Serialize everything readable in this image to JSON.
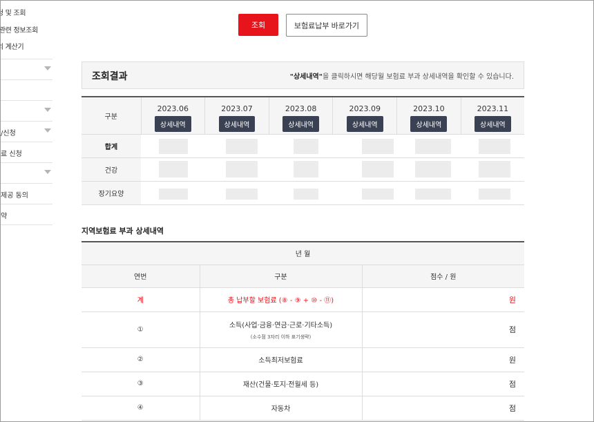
{
  "sidebar": {
    "sub_items": [
      "신청 및 조회",
      "료 관련 정보조회",
      "로의 계산기"
    ],
    "menu_items": [
      {
        "label": ""
      },
      {
        "label": ""
      },
      {
        "label": ""
      },
      {
        "label": "/신청"
      },
      {
        "label": "료 신청"
      },
      {
        "label": ""
      },
      {
        "label": "제공 동의"
      },
      {
        "label": "약"
      }
    ]
  },
  "actions": {
    "search_label": "조회",
    "pay_label": "보험료납부 바로가기"
  },
  "result": {
    "title": "조회결과",
    "info_bold": "\"상세내역\"",
    "info_rest": "을 클릭하시면 해당월 보험료 부과 상세내역을 확인할 수 있습니다."
  },
  "monthly_table": {
    "corner_label": "구분",
    "detail_label": "상세내역",
    "months": [
      "2023.06",
      "2023.07",
      "2023.08",
      "2023.09",
      "2023.10",
      "2023.11"
    ],
    "rows": [
      "합계",
      "건강",
      "장기요양"
    ]
  },
  "detail": {
    "title": "지역보험료 부과 상세내역",
    "period_header": "년 월",
    "col_no": "연번",
    "col_category": "구분",
    "col_score": "점수 / 원",
    "rows": [
      {
        "no": "계",
        "category": "총 납부할 보험료 (⑧ - ⑨ + ⑩ - ⑪)",
        "note": "",
        "unit": "원",
        "total": true
      },
      {
        "no": "①",
        "category": "소득(사업·금융·연금·근로·기타소득)",
        "note": "(소수점 3자리 이하 표기생략)",
        "unit": "점",
        "total": false
      },
      {
        "no": "②",
        "category": "소득최저보험료",
        "note": "",
        "unit": "원",
        "total": false
      },
      {
        "no": "③",
        "category": "재산(건물·토지·전월세 등)",
        "note": "",
        "unit": "점",
        "total": false
      },
      {
        "no": "④",
        "category": "자동차",
        "note": "",
        "unit": "점",
        "total": false
      }
    ]
  },
  "colors": {
    "accent_red": "#e8141b",
    "detail_button": "#3a4152"
  }
}
